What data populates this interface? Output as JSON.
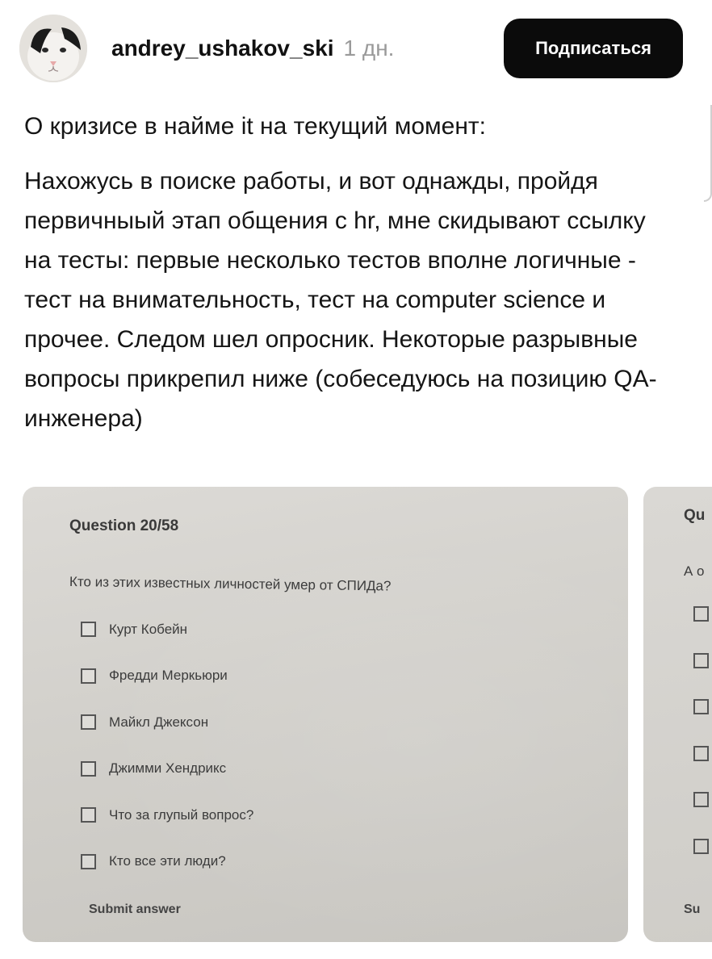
{
  "post": {
    "username": "andrey_ushakov_ski",
    "time": "1 дн.",
    "follow_label": "Подписаться",
    "title": "О кризисе в найме it на текущий момент:",
    "body": "Нахожусь в поиске работы, и вот однажды, пройдя первичныый этап общения с hr, мне скидывают ссылку на тесты: первые несколько тестов вполне логичные - тест на внимательность, тест на computer science и прочее. Следом шел опросник. Некоторые разрывные вопросы прикрепил ниже (собеседуюсь на позицию QA-инженера)"
  },
  "photo": {
    "question_header": "Question 20/58",
    "question_text": "Кто из этих известных личностей умер от СПИДа?",
    "options": [
      "Курт Кобейн",
      "Фредди Меркьюри",
      "Майкл Джексон",
      "Джимми Хендрикс",
      "Что за глупый вопрос?",
      "Кто все эти люди?"
    ],
    "submit_label": "Submit answer"
  },
  "next_photo": {
    "header_fragment": "Qu",
    "text_fragment": "А о",
    "submit_fragment": "Su"
  }
}
